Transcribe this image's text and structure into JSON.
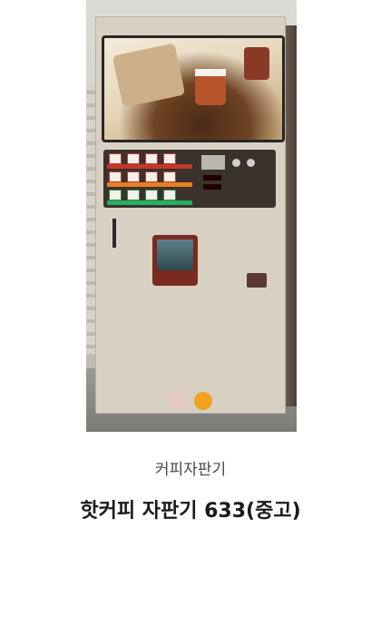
{
  "product": {
    "category": "커피자판기",
    "title": "핫커피 자판기 633(중고)",
    "image_alt": "coffee vending machine photo"
  },
  "carousel": {
    "slide_count": 2,
    "active_index": 1,
    "dot_colors": [
      "#e8c9c0",
      "#f0a21e"
    ]
  }
}
